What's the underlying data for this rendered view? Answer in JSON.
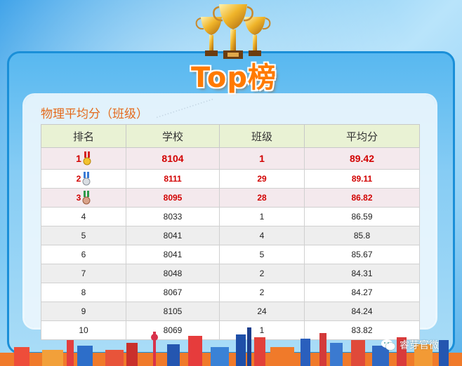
{
  "header": {
    "title": "Top榜"
  },
  "panel": {
    "title": "物理平均分（班级）"
  },
  "table": {
    "columns": [
      "排名",
      "学校",
      "班级",
      "平均分"
    ],
    "rows": [
      {
        "rank": "1",
        "school": "8104",
        "class": "1",
        "avg": "89.42"
      },
      {
        "rank": "2",
        "school": "8111",
        "class": "29",
        "avg": "89.11"
      },
      {
        "rank": "3",
        "school": "8095",
        "class": "28",
        "avg": "86.82"
      },
      {
        "rank": "4",
        "school": "8033",
        "class": "1",
        "avg": "86.59"
      },
      {
        "rank": "5",
        "school": "8041",
        "class": "4",
        "avg": "85.8"
      },
      {
        "rank": "6",
        "school": "8041",
        "class": "5",
        "avg": "85.67"
      },
      {
        "rank": "7",
        "school": "8048",
        "class": "2",
        "avg": "84.31"
      },
      {
        "rank": "8",
        "school": "8067",
        "class": "2",
        "avg": "84.27"
      },
      {
        "rank": "9",
        "school": "8105",
        "class": "24",
        "avg": "84.24"
      },
      {
        "rank": "10",
        "school": "8069",
        "class": "1",
        "avg": "83.82"
      }
    ]
  },
  "footer": {
    "brand": "睿芽官微"
  },
  "colors": {
    "accent": "#ff7a00",
    "top_rank_text": "#d20000",
    "frame": "#1a8fd8",
    "header_row": "#e9f2d4"
  },
  "icons": {
    "medal_1": "gold-medal-icon",
    "medal_2": "silver-medal-icon",
    "medal_3": "bronze-medal-icon",
    "trophy": "trophy-icon",
    "brand": "wechat-icon"
  }
}
